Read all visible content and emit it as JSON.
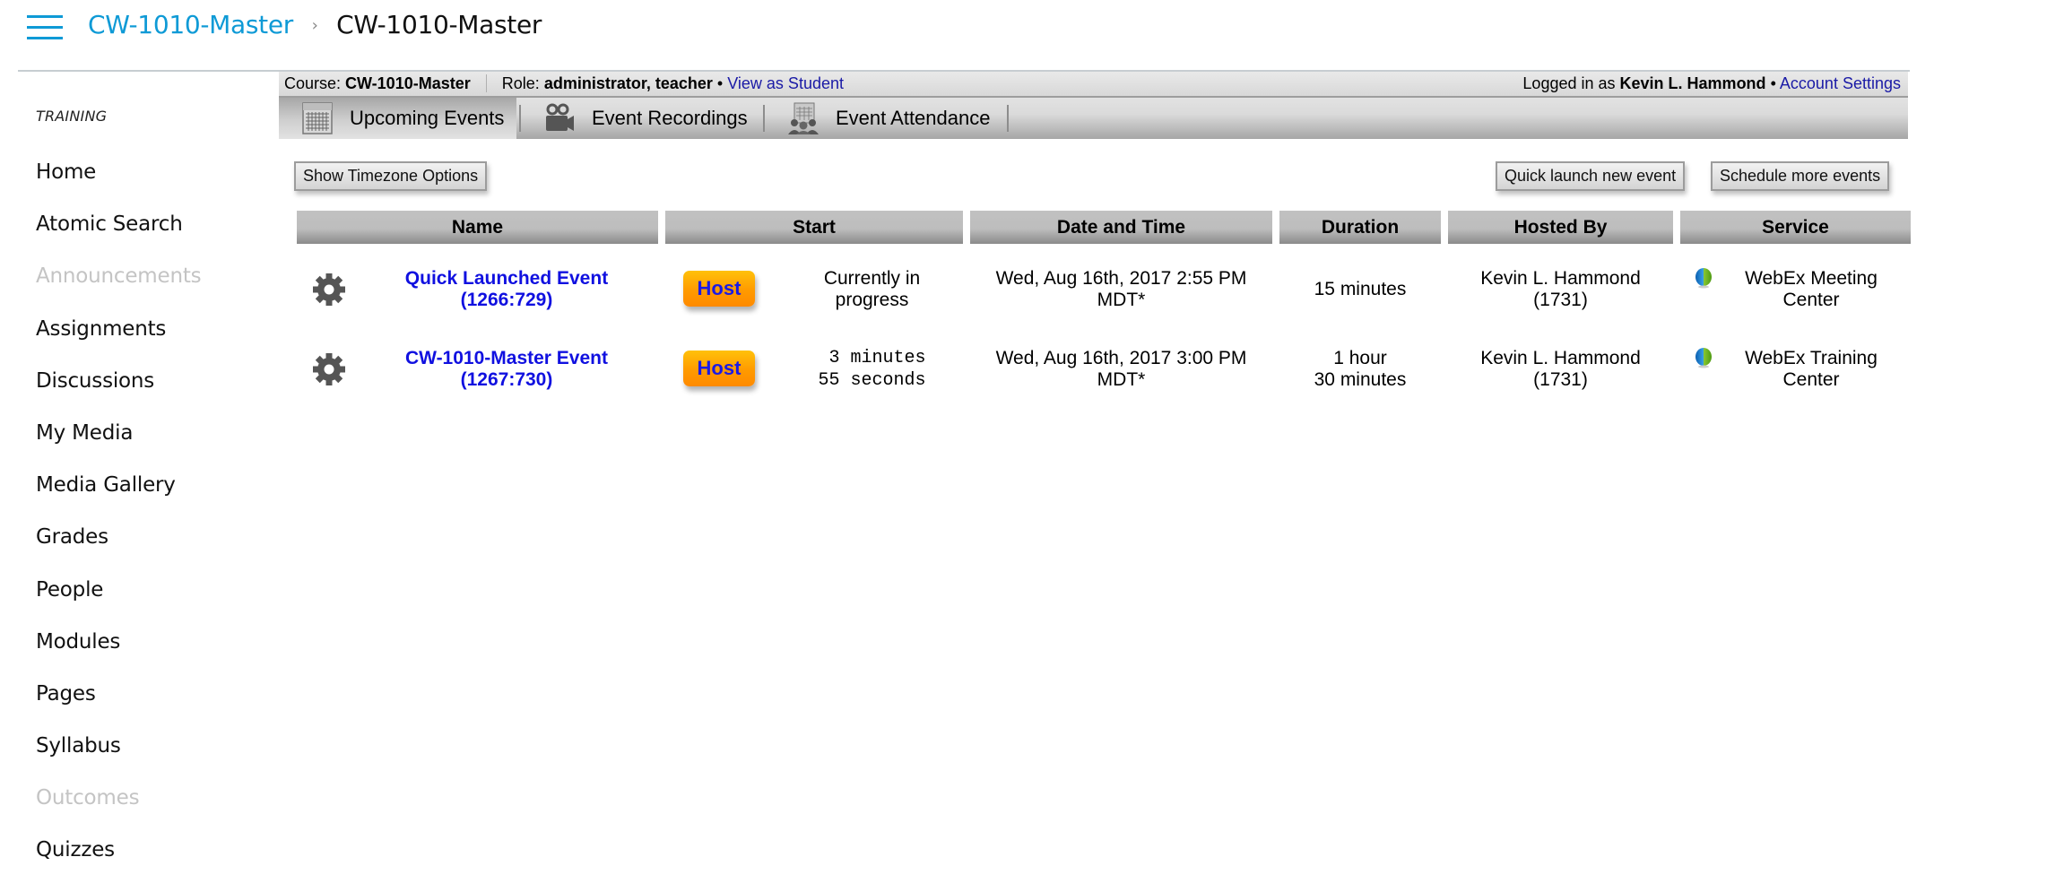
{
  "header": {
    "menu_icon": "hamburger-icon",
    "breadcrumb": {
      "link": "CW-1010-Master",
      "separator": "›",
      "current": "CW-1010-Master"
    }
  },
  "sidebar": {
    "section_label": "TRAINING",
    "items": [
      {
        "label": "Home",
        "disabled": false
      },
      {
        "label": "Atomic Search",
        "disabled": false
      },
      {
        "label": "Announcements",
        "disabled": true
      },
      {
        "label": "Assignments",
        "disabled": false
      },
      {
        "label": "Discussions",
        "disabled": false
      },
      {
        "label": "My Media",
        "disabled": false
      },
      {
        "label": "Media Gallery",
        "disabled": false
      },
      {
        "label": "Grades",
        "disabled": false
      },
      {
        "label": "People",
        "disabled": false
      },
      {
        "label": "Modules",
        "disabled": false
      },
      {
        "label": "Pages",
        "disabled": false
      },
      {
        "label": "Syllabus",
        "disabled": false
      },
      {
        "label": "Outcomes",
        "disabled": true
      },
      {
        "label": "Quizzes",
        "disabled": false
      }
    ]
  },
  "infobar": {
    "course_label": "Course:",
    "course_value": "CW-1010-Master",
    "role_label": "Role:",
    "role_value": "administrator, teacher",
    "bullet": "•",
    "view_as_student": "View as Student",
    "logged_in_label": "Logged in as",
    "user_name": "Kevin L. Hammond",
    "account_settings": "Account Settings"
  },
  "tabs": [
    {
      "label": "Upcoming Events",
      "icon": "calendar-icon",
      "active": true
    },
    {
      "label": "Event Recordings",
      "icon": "video-camera-icon",
      "active": false
    },
    {
      "label": "Event Attendance",
      "icon": "attendance-icon",
      "active": false
    }
  ],
  "toolbar": {
    "timezone_button": "Show Timezone Options",
    "quick_launch_button": "Quick launch new event",
    "schedule_button": "Schedule more events"
  },
  "table": {
    "columns": [
      "Name",
      "Start",
      "Date and Time",
      "Duration",
      "Hosted By",
      "Service"
    ],
    "rows": [
      {
        "name_line1": "Quick Launched Event",
        "name_line2": "(1266:729)",
        "host_label": "Host",
        "start_line1": "Currently in",
        "start_line2": "progress",
        "start_mono": false,
        "datetime_line1": "Wed, Aug 16th, 2017 2:55 PM",
        "datetime_line2": "MDT*",
        "duration_line1": "15 minutes",
        "duration_line2": "",
        "host_line1": "Kevin L. Hammond",
        "host_line2": "(1731)",
        "service_line1": "WebEx Meeting",
        "service_line2": "Center"
      },
      {
        "name_line1": "CW-1010-Master Event",
        "name_line2": "(1267:730)",
        "host_label": "Host",
        "start_line1": " 3 minutes",
        "start_line2": "55 seconds",
        "start_mono": true,
        "datetime_line1": "Wed, Aug 16th, 2017 3:00 PM",
        "datetime_line2": "MDT*",
        "duration_line1": "1 hour",
        "duration_line2": "30 minutes",
        "host_line1": "Kevin L. Hammond",
        "host_line2": "(1731)",
        "service_line1": "WebEx Training",
        "service_line2": "Center"
      }
    ]
  },
  "colors": {
    "brand_link": "#0e9ad6",
    "event_link": "#1010e0",
    "host_button": "#ff9a00",
    "disabled_nav": "#c4c4c4"
  }
}
